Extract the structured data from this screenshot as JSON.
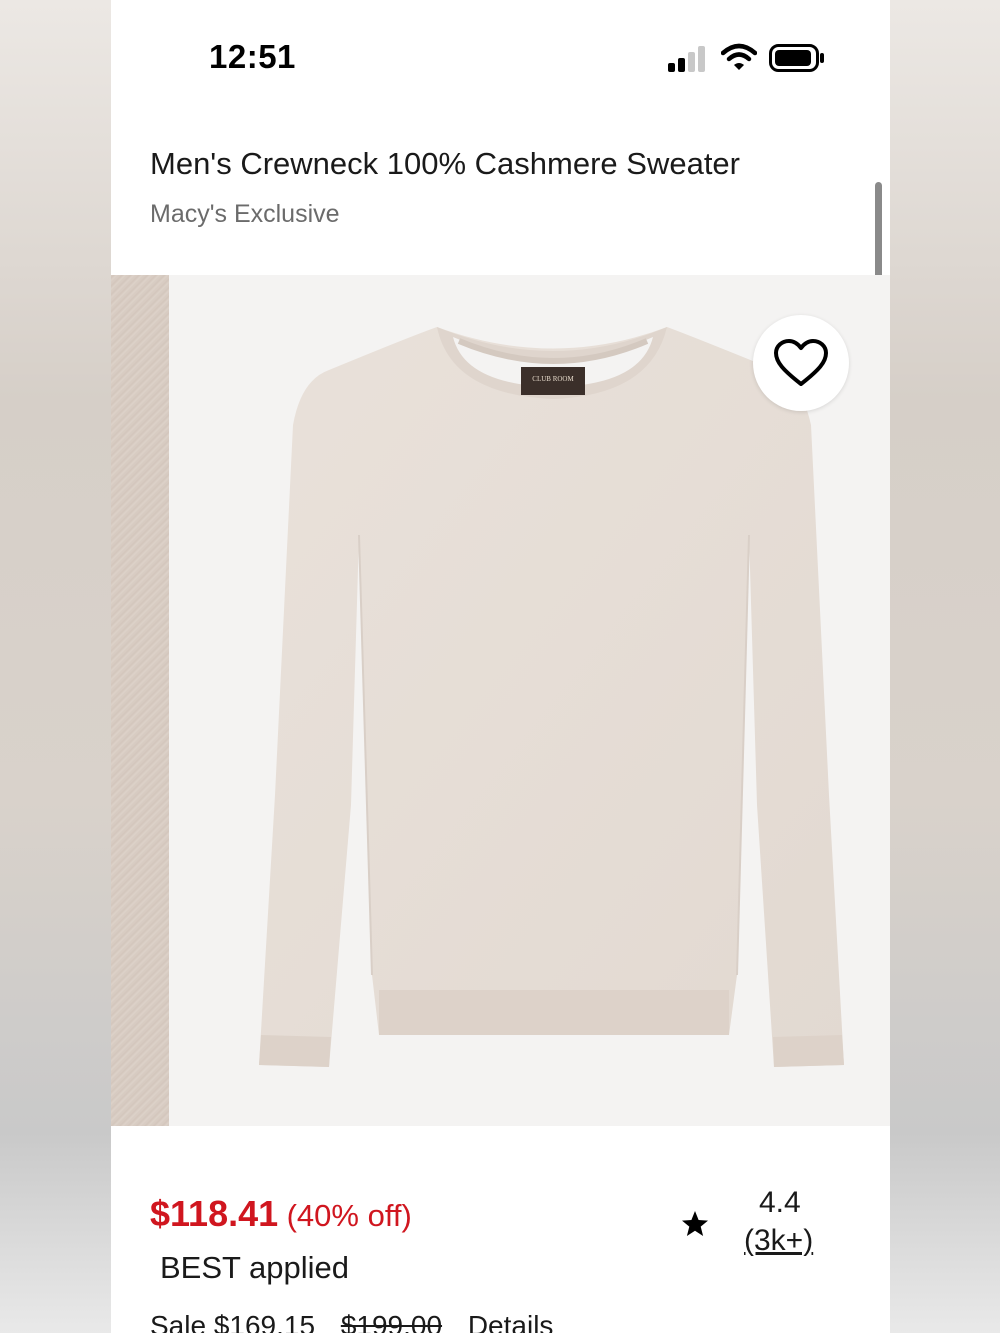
{
  "status_bar": {
    "time": "12:51",
    "signal_bars_filled": 2,
    "signal_bars_total": 4
  },
  "product": {
    "title": "Men's Crewneck 100% Cashmere Sweater",
    "subtitle": "Macy's Exclusive",
    "label_brand": "CLUB ROOM"
  },
  "pricing": {
    "price": "$118.41",
    "discount": "(40% off)",
    "promo_applied": "BEST applied",
    "sale_label": "Sale $169.15",
    "original_price": "$199.00",
    "details_link": "Details"
  },
  "rating": {
    "value": "4.4",
    "count": "(3k+)"
  },
  "icons": {
    "favorite": "heart-outline-icon",
    "rating": "star-icon"
  },
  "colors": {
    "price_red": "#d0161f",
    "sweater": "#e6ddd6"
  }
}
